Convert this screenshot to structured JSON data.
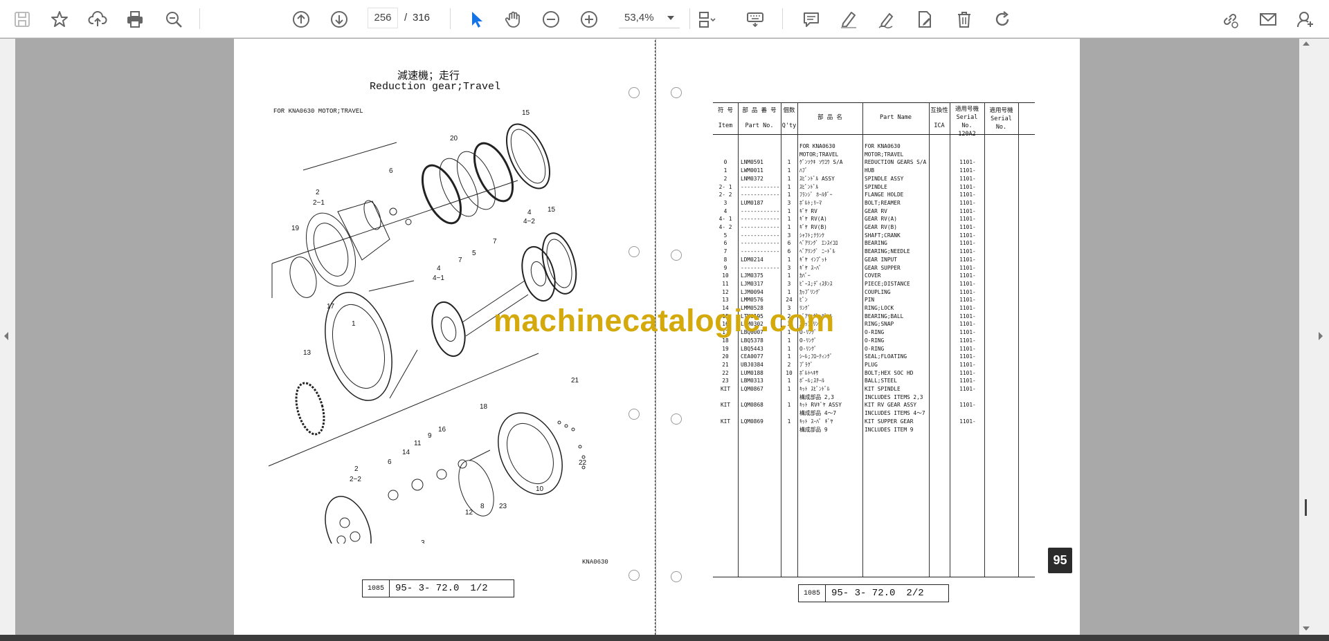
{
  "toolbar": {
    "left_icons": [
      "save-icon",
      "bookmark-star-icon",
      "upload-cloud-icon",
      "print-icon",
      "zoom-search-icon"
    ],
    "nav_icons": [
      "arrow-up-circle-icon",
      "arrow-down-circle-icon"
    ],
    "current_page": "256",
    "page_separator": "/",
    "total_pages": "316",
    "tool_icons": [
      "select-pointer-icon",
      "hand-pan-icon",
      "zoom-out-icon",
      "zoom-in-icon"
    ],
    "zoom": "53,4%",
    "right_tools": [
      "fit-page-icon",
      "keyboard-icon",
      "comment-icon",
      "highlight-pen-icon",
      "sign-pen-icon",
      "edit-document-icon",
      "trash-icon",
      "rotate-icon"
    ],
    "far_right": [
      "share-link-icon",
      "mail-icon",
      "add-user-icon"
    ],
    "accent_color": "#1473e6"
  },
  "left_page": {
    "title_jp": "減速機；走行",
    "title_en": "Reduction gear;Travel",
    "subtitle": "FOR KNA0630 MOTOR;TRAVEL",
    "drawing_code": "KNA0630",
    "footer_code": "1085",
    "footer_ref": "95- 3- 72.0",
    "footer_page": "1/2",
    "callouts": [
      "15",
      "20",
      "6",
      "2",
      "2-1",
      "19",
      "17",
      "4",
      "4-2",
      "15",
      "5",
      "7",
      "7",
      "4",
      "4-1",
      "1",
      "13",
      "21",
      "18",
      "16",
      "9",
      "11",
      "14",
      "6",
      "2",
      "2-2",
      "12",
      "8",
      "23",
      "10",
      "22",
      "3"
    ]
  },
  "right_page": {
    "header": {
      "item_jp": "符 号",
      "item_en": "Item",
      "partno_jp": "部 品 番 号",
      "partno_en": "Part No.",
      "qty_jp": "個数",
      "qty_en": "Q'ty",
      "name_jp": "部 品 名",
      "name_en": "Part Name",
      "ica_jp": "互換性",
      "ica_en": "ICA",
      "serial_jp": "適用号機",
      "serial_en": "Serial No.",
      "serial_model": "120A2",
      "serial2_jp": "適用号機",
      "serial2_en": "Serial No."
    },
    "rows": [
      [
        "",
        "",
        "",
        "FOR KNA0630",
        "FOR KNA0630",
        ""
      ],
      [
        "",
        "",
        "",
        "MOTOR;TRAVEL",
        "MOTOR;TRAVEL",
        ""
      ],
      [
        "0",
        "LNM0591",
        "1",
        "ｹﾞﾝｿｸｷ ｿｳｺｳ S/A",
        "REDUCTION GEARS S/A",
        "1101-"
      ],
      [
        "1",
        "LWM0011",
        "1",
        "ﾊﾌﾞ",
        "HUB",
        "1101-"
      ],
      [
        "2",
        "LNM0372",
        "1",
        "ｽﾋﾟﾝﾄﾞﾙ ASSY",
        "SPINDLE ASSY",
        "1101-"
      ],
      [
        "2- 1",
        "------------",
        "1",
        "ｽﾋﾟﾝﾄﾞﾙ",
        "SPINDLE",
        "1101-"
      ],
      [
        "2- 2",
        "------------",
        "1",
        "ﾌﾗﾝｼﾞ ﾎｰﾙﾀﾞｰ",
        "FLANGE HOLDE",
        "1101-"
      ],
      [
        "3",
        "LUM0187",
        "3",
        "ﾎﾞﾙﾄ;ﾘｰﾏ",
        "BOLT;REAMER",
        "1101-"
      ],
      [
        "4",
        "------------",
        "1",
        "ｷﾞﾔ RV",
        "GEAR RV",
        "1101-"
      ],
      [
        "4- 1",
        "------------",
        "1",
        "ｷﾞﾔ RV(A)",
        "GEAR RV(A)",
        "1101-"
      ],
      [
        "4- 2",
        "------------",
        "1",
        "ｷﾞﾔ RV(B)",
        "GEAR RV(B)",
        "1101-"
      ],
      [
        "5",
        "------------",
        "3",
        "ｼｬﾌﾄ;ｸﾗﾝｸ",
        "SHAFT;CRANK",
        "1101-"
      ],
      [
        "6",
        "------------",
        "6",
        "ﾍﾞｱﾘﾝｸﾞ ｴﾝｽｲｺﾛ",
        "BEARING",
        "1101-"
      ],
      [
        "7",
        "------------",
        "6",
        "ﾍﾞｱﾘﾝｸﾞ ﾆｰﾄﾞﾙ",
        "BEARING;NEEDLE",
        "1101-"
      ],
      [
        "8",
        "LDM0214",
        "1",
        "ｷﾞﾔ ｲﾝﾌﾟｯﾄ",
        "GEAR INPUT",
        "1101-"
      ],
      [
        "9",
        "------------",
        "3",
        "ｷﾞﾔ ｽｰﾊﾟ",
        "GEAR SUPPER",
        "1101-"
      ],
      [
        "10",
        "LJM0375",
        "1",
        "ｶﾊﾞｰ",
        "COVER",
        "1101-"
      ],
      [
        "11",
        "LJM0317",
        "3",
        "ﾋﾟｰｽ;ﾃﾞｨｽﾀﾝｽ",
        "PIECE;DISTANCE",
        "1101-"
      ],
      [
        "12",
        "LJM0094",
        "1",
        "ｶｯﾌﾟﾘﾝｸﾞ",
        "COUPLING",
        "1101-"
      ],
      [
        "13",
        "LMM0576",
        "24",
        "ﾋﾟﾝ",
        "PIN",
        "1101-"
      ],
      [
        "14",
        "LMM0528",
        "3",
        "ﾘﾝｸﾞ",
        "RING;LOCK",
        "1101-"
      ],
      [
        "15",
        "LTM0195",
        "2",
        "ﾍﾞｱﾘﾝｸﾞ;ﾎﾞｰﾙ",
        "BEARING;BALL",
        "1101-"
      ],
      [
        "16",
        "LTM0302",
        "3",
        "ｽﾅｯﾌﾟﾘﾝｸﾞ",
        "RING;SNAP",
        "1101-"
      ],
      [
        "17",
        "LBQ0007",
        "1",
        "O-ﾘﾝｸﾞ",
        "O-RING",
        "1101-"
      ],
      [
        "18",
        "LBQ5378",
        "1",
        "O-ﾘﾝｸﾞ",
        "O-RING",
        "1101-"
      ],
      [
        "19",
        "LBQ5443",
        "1",
        "O-ﾘﾝｸﾞ",
        "O-RING",
        "1101-"
      ],
      [
        "20",
        "CEA0077",
        "1",
        "ｼｰﾙ;ﾌﾛｰﾃｨﾝｸﾞ",
        "SEAL;FLOATING",
        "1101-"
      ],
      [
        "21",
        "UBJ0384",
        "2",
        "ﾌﾟﾗｸﾞ",
        "PLUG",
        "1101-"
      ],
      [
        "22",
        "LUM0188",
        "10",
        "ﾎﾞﾙﾄﾍｷｻ",
        "BOLT;HEX SOC HD",
        "1101-"
      ],
      [
        "23",
        "LBM0313",
        "1",
        "ﾎﾞｰﾙ;ｽﾁｰﾙ",
        "BALL;STEEL",
        "1101-"
      ],
      [
        "KIT",
        "LQM0867",
        "1",
        "ｷｯﾄ ｽﾋﾟﾝﾄﾞﾙ",
        "KIT SPINDLE",
        "1101-"
      ],
      [
        "",
        "",
        "",
        "構成部品 2,3",
        "INCLUDES ITEMS 2,3",
        ""
      ],
      [
        "KIT",
        "LQM0868",
        "1",
        "ｷｯﾄ RVｷﾞﾔ ASSY",
        "KIT RV GEAR ASSY",
        "1101-"
      ],
      [
        "",
        "",
        "",
        "構成部品 4～7",
        "INCLUDES ITEMS 4～7",
        ""
      ],
      [
        "KIT",
        "LQM0869",
        "1",
        "ｷｯﾄ ｽｰﾊﾟ ｷﾞﾔ",
        "KIT SUPPER GEAR",
        "1101-"
      ],
      [
        "",
        "",
        "",
        "構成部品 9",
        "INCLUDES ITEM 9",
        ""
      ]
    ],
    "footer_code": "1085",
    "footer_ref": "95- 3- 72.0",
    "footer_page": "2/2",
    "section_badge": "95"
  },
  "watermark": "machinecatalogic.com"
}
